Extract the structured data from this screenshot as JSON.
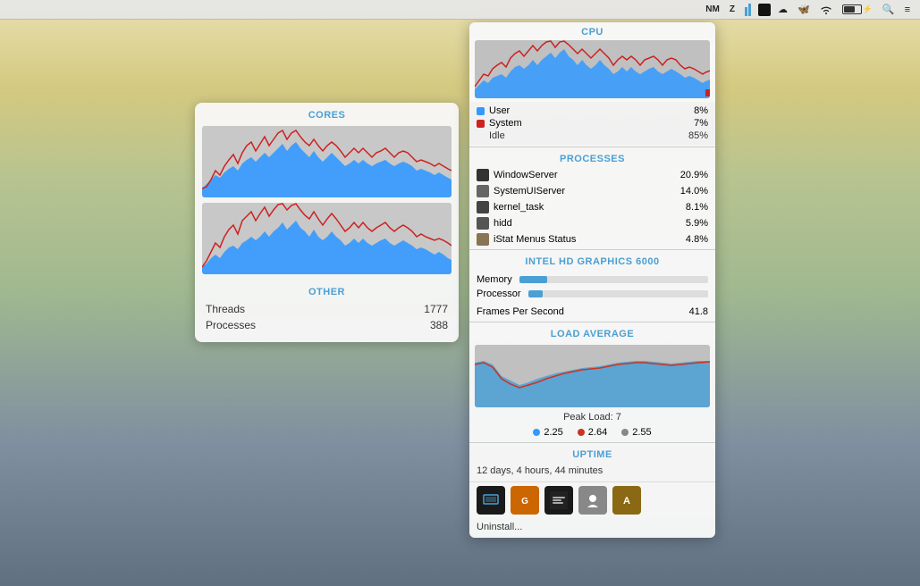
{
  "menubar": {
    "items": [
      "NM",
      "Z",
      "battery_icon",
      "cloud_icon",
      "butterfly_icon",
      "wifi_icon",
      "battery_charging",
      "search_icon",
      "menu_icon"
    ]
  },
  "cores_panel": {
    "title": "CORES",
    "other_title": "OTHER",
    "threads_label": "Threads",
    "threads_value": "1777",
    "processes_label": "Processes",
    "processes_value": "388"
  },
  "cpu_section": {
    "header": "CPU",
    "user_label": "User",
    "user_value": "8%",
    "system_label": "System",
    "system_value": "7%",
    "idle_label": "Idle",
    "idle_value": "85%"
  },
  "processes_section": {
    "header": "PROCESSES",
    "items": [
      {
        "name": "WindowServer",
        "value": "20.9%"
      },
      {
        "name": "SystemUIServer",
        "value": "14.0%"
      },
      {
        "name": "kernel_task",
        "value": "8.1%"
      },
      {
        "name": "hidd",
        "value": "5.9%"
      },
      {
        "name": "iStat Menus Status",
        "value": "4.8%"
      }
    ]
  },
  "intel_section": {
    "header": "INTEL HD GRAPHICS 6000",
    "memory_label": "Memory",
    "memory_pct": 15,
    "processor_label": "Processor",
    "processor_pct": 8,
    "fps_label": "Frames Per Second",
    "fps_value": "41.8"
  },
  "load_section": {
    "header": "LOAD AVERAGE",
    "peak_label": "Peak Load: 7",
    "val1": "2.25",
    "val2": "2.64",
    "val3": "2.55"
  },
  "uptime_section": {
    "header": "UPTIME",
    "value": "12 days, 4 hours, 44 minutes"
  },
  "uninstall": {
    "label": "Uninstall..."
  }
}
